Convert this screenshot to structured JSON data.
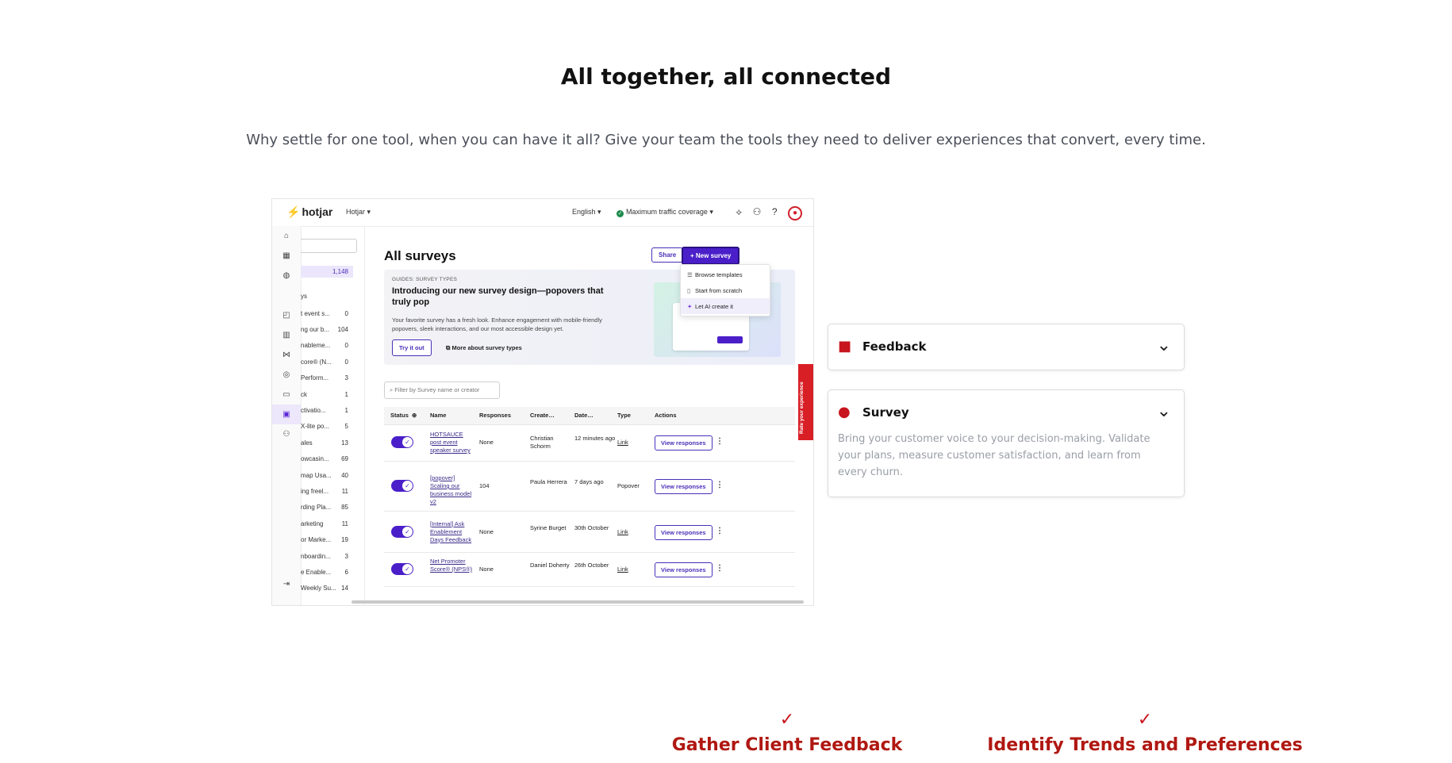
{
  "section": {
    "title": "All together, all connected",
    "subtitle": "Why settle for one tool, when you can have it all? Give your team the tools they need to deliver experiences that convert, every time."
  },
  "app": {
    "logo": "hotjar",
    "site": "Hotjar",
    "language": "English",
    "traffic": "Maximum traffic coverage",
    "page_title": "All surveys",
    "share_label": "Share",
    "new_survey_label": "+ New survey",
    "dropdown": [
      "Browse templates",
      "Start from scratch",
      "Let AI create it"
    ],
    "banner": {
      "kicker": "GUIDES: SURVEY TYPES",
      "title": "Introducing our new survey design—popovers that truly pop",
      "body": "Your favorite survey has a fresh look. Enhance engagement with mobile-friendly popovers, sleek interactions, and our most accessible design yet.",
      "try_label": "Try it out",
      "link_label": "More about survey types"
    },
    "filter_placeholder": "Filter by Survey name or creator",
    "columns": [
      "Status",
      "Name",
      "Responses",
      "Create…",
      "Date…",
      "Type",
      "Actions"
    ],
    "rows": [
      {
        "name": "HOTSAUCE post event speaker survey",
        "responses": "None",
        "creator": "Christian Schorm",
        "date": "12 minutes ago",
        "type": "Link",
        "action": "View responses"
      },
      {
        "name": "[popover] Scaling our business model v2",
        "responses": "104",
        "creator": "Paula Herrera",
        "date": "7 days ago",
        "type": "Popover",
        "action": "View responses"
      },
      {
        "name": "[Internal] Ask Enablement Days Feedback",
        "responses": "None",
        "creator": "Syrine Burget",
        "date": "30th October",
        "type": "Link",
        "action": "View responses"
      },
      {
        "name": "Net Promoter Score® (NPS®)",
        "responses": "None",
        "creator": "Daniel Doherty",
        "date": "26th October",
        "type": "Link",
        "action": "View responses"
      }
    ],
    "sidebar": {
      "count": "1,148",
      "header": "ys",
      "items": [
        {
          "label": "t event s...",
          "count": "0"
        },
        {
          "label": "ng our b...",
          "count": "104"
        },
        {
          "label": "nableme...",
          "count": "0"
        },
        {
          "label": "core® (N...",
          "count": "0"
        },
        {
          "label": "Perform...",
          "count": "3"
        },
        {
          "label": "ck",
          "count": "1"
        },
        {
          "label": "ctivatio...",
          "count": "1"
        },
        {
          "label": "X-lite po...",
          "count": "5"
        },
        {
          "label": "ales",
          "count": "13"
        },
        {
          "label": "owcasin...",
          "count": "69"
        },
        {
          "label": "map Usa...",
          "count": "40"
        },
        {
          "label": "ing freel...",
          "count": "11"
        },
        {
          "label": "rding Pla...",
          "count": "85"
        },
        {
          "label": "arketing",
          "count": "11"
        },
        {
          "label": "or Marke...",
          "count": "19"
        },
        {
          "label": "nboardin...",
          "count": "3"
        },
        {
          "label": "e Enable...",
          "count": "6"
        },
        {
          "label": "Weekly Su...",
          "count": "14"
        }
      ]
    },
    "rate_tab": "Rate your experience"
  },
  "accordion": [
    {
      "title": "Feedback",
      "body": ""
    },
    {
      "title": "Survey",
      "body": "Bring your customer voice to your decision-making. Validate your plans, measure customer satisfaction, and learn from every churn."
    }
  ],
  "benefits": [
    {
      "title": "Gather Client Feedback"
    },
    {
      "title": "Identify Trends and Preferences"
    }
  ],
  "colors": {
    "accent": "#c8161e",
    "brand_purple": "#4a1fc9"
  }
}
